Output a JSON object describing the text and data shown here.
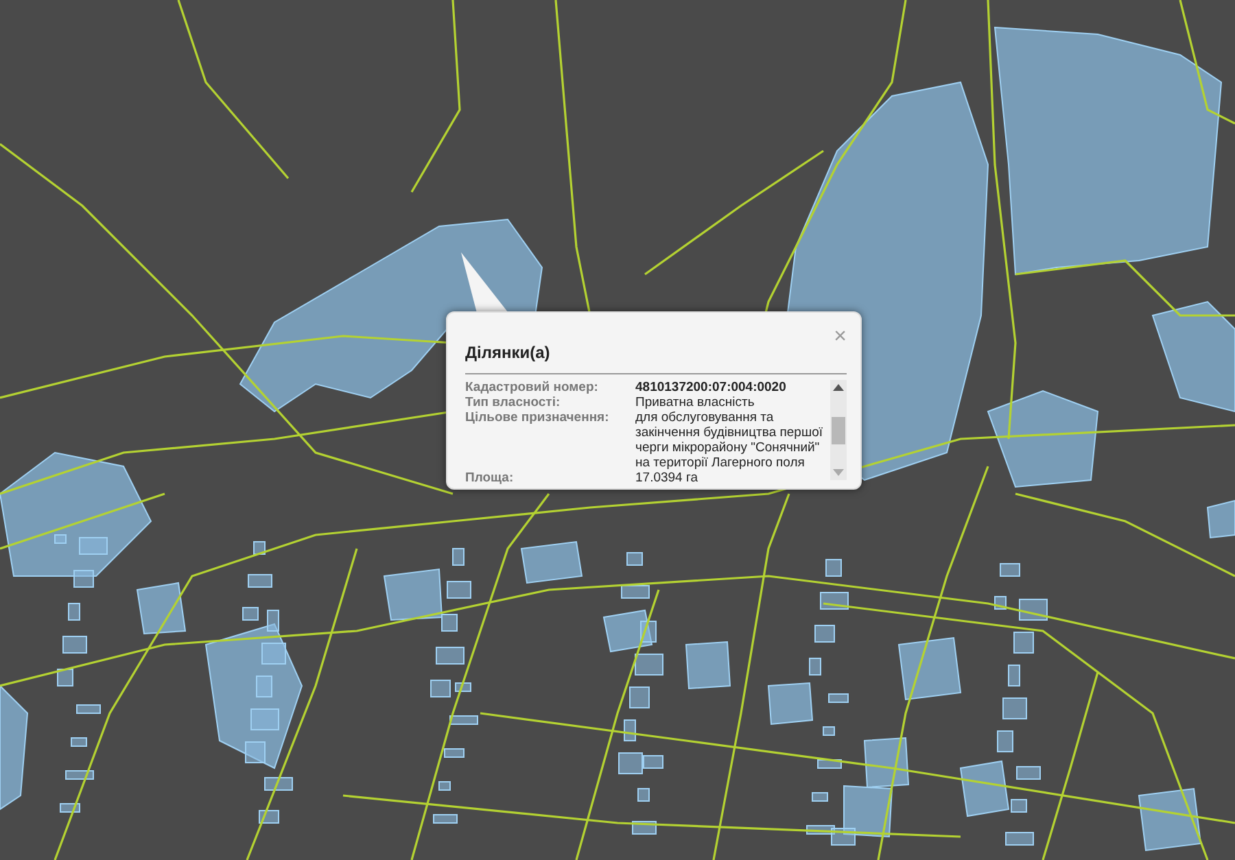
{
  "popup": {
    "title": "Ділянки(а)",
    "close": "×",
    "fields": [
      {
        "label": "Кадастровий номер:",
        "value": "4810137200:07:004:0020",
        "bold": true
      },
      {
        "label": "Тип власності:",
        "value": "Приватна власність",
        "bold": false
      },
      {
        "label": "Цільове призначення:",
        "value": "для обслуговування та закінчення будівництва першої черги мікрорайону \"Сонячний\" на території Лагерного поля",
        "bold": false
      },
      {
        "label": "Площа:",
        "value": "17.0394 га",
        "bold": false
      }
    ]
  }
}
